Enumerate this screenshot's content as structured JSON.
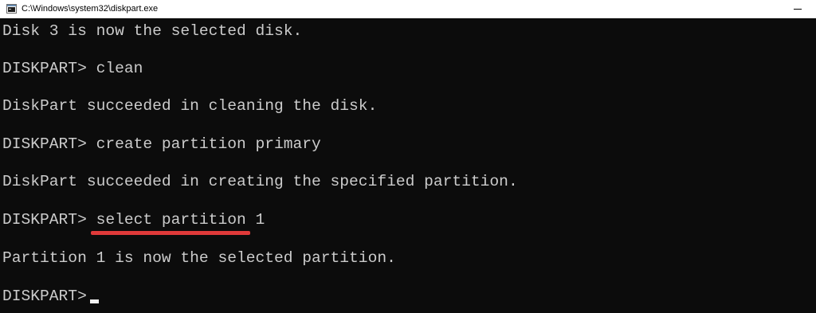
{
  "window": {
    "title": "C:\\Windows\\system32\\diskpart.exe",
    "icon": "console-app-icon",
    "minimize_icon": "minimize-icon"
  },
  "console": {
    "lines": [
      "Disk 3 is now the selected disk.",
      "DISKPART> clean",
      "DiskPart succeeded in cleaning the disk.",
      "DISKPART> create partition primary",
      "DiskPart succeeded in creating the specified partition.",
      "DISKPART> select partition 1",
      "Partition 1 is now the selected partition.",
      "DISKPART> "
    ],
    "highlighted_command": "select partition 1",
    "text_color": "#cccccc",
    "background_color": "#0c0c0c",
    "highlight_color": "#e03a3a"
  }
}
